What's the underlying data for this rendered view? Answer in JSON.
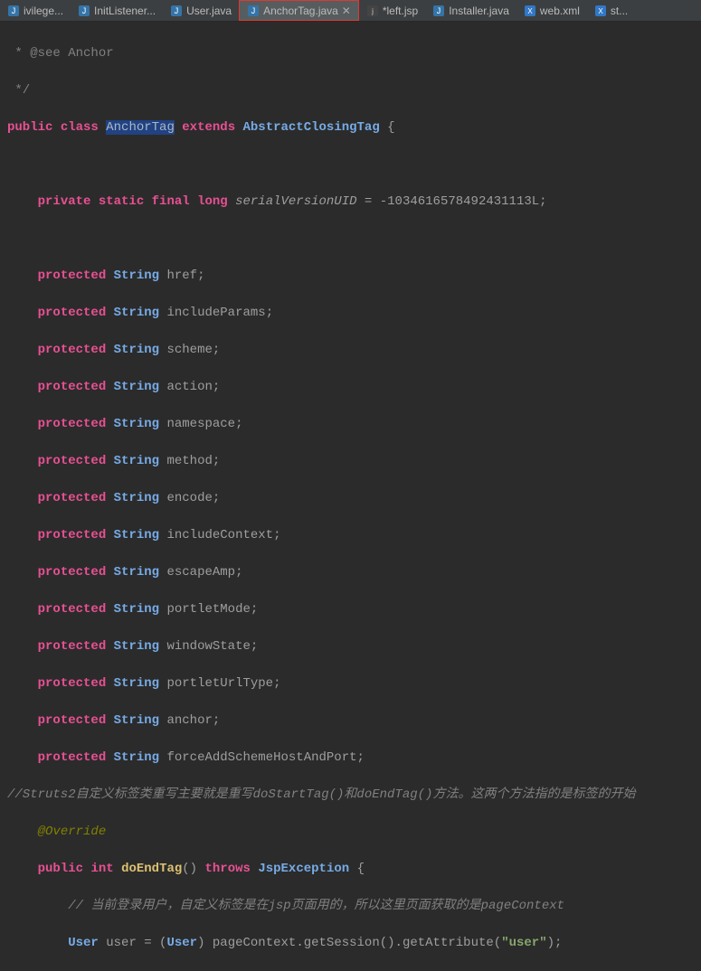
{
  "tabs": [
    {
      "label": "ivilege...",
      "icon": "java"
    },
    {
      "label": "InitListener...",
      "icon": "java"
    },
    {
      "label": "User.java",
      "icon": "java"
    },
    {
      "label": "AnchorTag.java",
      "icon": "java",
      "active": true,
      "modified": true
    },
    {
      "label": "*left.jsp",
      "icon": "jsp"
    },
    {
      "label": "Installer.java",
      "icon": "java"
    },
    {
      "label": "web.xml",
      "icon": "xml"
    },
    {
      "label": "st...",
      "icon": "xml"
    }
  ],
  "code": {
    "see": " * @see Anchor",
    "cend": " */",
    "pub": "public",
    "cls": "class",
    "clsName": "AnchorTag",
    "ext": "extends",
    "superName": "AbstractClosingTag",
    "l4": "    ",
    "priv": "private",
    "static": "static",
    "final": "final",
    "long": "long",
    "svu": "serialVersionUID",
    "svuVal": "-1034616578492431113L",
    "prot": "protected",
    "string": "String",
    "f_href": "href",
    "f_incParams": "includeParams",
    "f_scheme": "scheme",
    "f_action": "action",
    "f_namespace": "namespace",
    "f_method": "method",
    "f_encode": "encode",
    "f_incCtx": "includeContext",
    "f_escAmp": "escapeAmp",
    "f_portMode": "portletMode",
    "f_winState": "windowState",
    "f_portUrlType": "portletUrlType",
    "f_anchor": "anchor",
    "f_force": "forceAddSchemeHostAndPort",
    "cn1": "//Struts2自定义标签类重写主要就是重写doStartTag()和doEndTag()方法。这两个方法指的是标签的开始",
    "ov": "@Override",
    "int": "int",
    "method1": "doEndTag",
    "throws": "throws",
    "jspEx": "JspException",
    "cn2": "// 当前登录用户，自定义标签是在jsp页面用的，所以这里页面获取的是pageContext",
    "userType": "User",
    "userVar": "user",
    "pageCtx": "pageContext",
    "getSess": "getSession",
    "getAttr": "getAttribute",
    "userStr": "\"user\""
  }
}
